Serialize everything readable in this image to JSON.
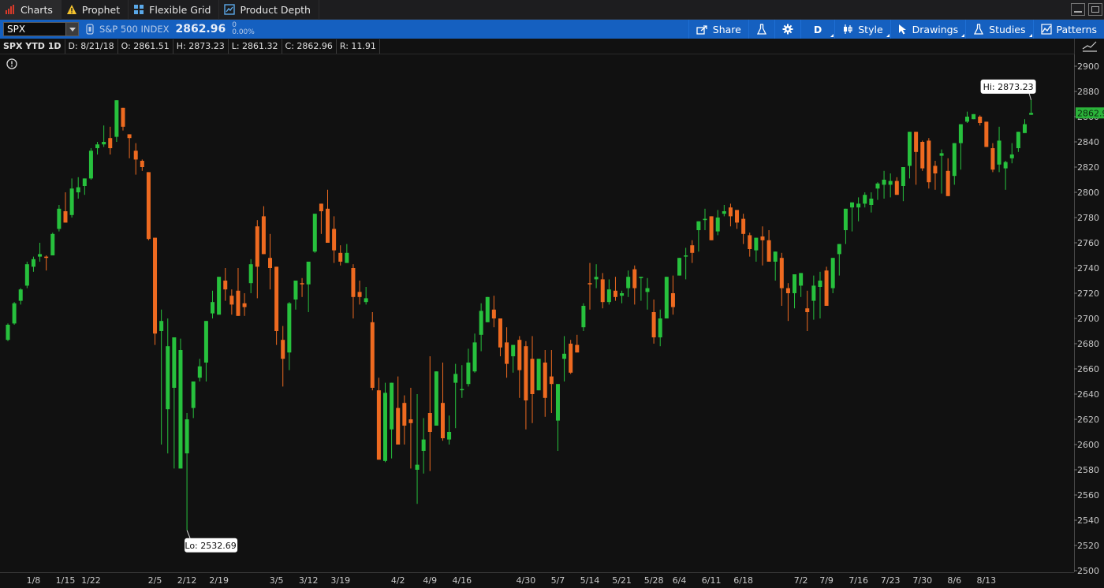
{
  "tabs": [
    {
      "label": "Charts",
      "icon": "bar-chart-icon"
    },
    {
      "label": "Prophet",
      "icon": "warning-triangle-icon"
    },
    {
      "label": "Flexible Grid",
      "icon": "grid-icon"
    },
    {
      "label": "Product Depth",
      "icon": "depth-chart-icon"
    }
  ],
  "toolbar": {
    "symbol": "SPX",
    "description": "S&P 500 INDEX",
    "last_price": "2862.96",
    "change": "0",
    "change_pct": "0.00%",
    "buttons": {
      "share": "Share",
      "aggregation": "D",
      "style": "Style",
      "drawings": "Drawings",
      "studies": "Studies",
      "patterns": "Patterns"
    }
  },
  "infobar": {
    "title": "SPX YTD 1D",
    "date": "D: 8/21/18",
    "open": "O: 2861.51",
    "high": "H: 2873.23",
    "low": "L: 2861.32",
    "close": "C: 2862.96",
    "range": "R: 11.91"
  },
  "colors": {
    "up": "#27c13d",
    "down": "#ee6a20",
    "background": "#111111",
    "toolbar": "#1560c0",
    "last_price_tag": "#2bb33a"
  },
  "chart_data": {
    "type": "candlestick",
    "ylim": [
      2500,
      2910
    ],
    "y_ticks": [
      2500,
      2520,
      2540,
      2560,
      2580,
      2600,
      2620,
      2640,
      2660,
      2680,
      2700,
      2720,
      2740,
      2760,
      2780,
      2800,
      2820,
      2840,
      2860,
      2880,
      2900
    ],
    "x_tick_labels": [
      {
        "label": "1/8",
        "index": 4
      },
      {
        "label": "1/15",
        "index": 9
      },
      {
        "label": "1/22",
        "index": 13
      },
      {
        "label": "2/5",
        "index": 23
      },
      {
        "label": "2/12",
        "index": 28
      },
      {
        "label": "2/19",
        "index": 33
      },
      {
        "label": "3/5",
        "index": 42
      },
      {
        "label": "3/12",
        "index": 47
      },
      {
        "label": "3/19",
        "index": 52
      },
      {
        "label": "4/2",
        "index": 61
      },
      {
        "label": "4/9",
        "index": 66
      },
      {
        "label": "4/16",
        "index": 71
      },
      {
        "label": "4/30",
        "index": 81
      },
      {
        "label": "5/7",
        "index": 86
      },
      {
        "label": "5/14",
        "index": 91
      },
      {
        "label": "5/21",
        "index": 96
      },
      {
        "label": "5/28",
        "index": 101
      },
      {
        "label": "6/4",
        "index": 105
      },
      {
        "label": "6/11",
        "index": 110
      },
      {
        "label": "6/18",
        "index": 115
      },
      {
        "label": "7/2",
        "index": 124
      },
      {
        "label": "7/9",
        "index": 128
      },
      {
        "label": "7/16",
        "index": 133
      },
      {
        "label": "7/23",
        "index": 138
      },
      {
        "label": "7/30",
        "index": 143
      },
      {
        "label": "8/6",
        "index": 148
      },
      {
        "label": "8/13",
        "index": 153
      }
    ],
    "hi_label": "Hi: 2873.23",
    "lo_label": "Lo: 2532.69",
    "last_price_label": "2862.96",
    "candles": [
      [
        2683,
        2696,
        2682,
        2695
      ],
      [
        2696,
        2713,
        2695,
        2712
      ],
      [
        2714,
        2724,
        2711,
        2723
      ],
      [
        2726,
        2745,
        2724,
        2743
      ],
      [
        2741,
        2749,
        2737,
        2747
      ],
      [
        2749,
        2760,
        2745,
        2751
      ],
      [
        2749,
        2750,
        2738,
        2748
      ],
      [
        2750,
        2768,
        2750,
        2767
      ],
      [
        2771,
        2790,
        2769,
        2787
      ],
      [
        2785,
        2800,
        2777,
        2776
      ],
      [
        2782,
        2811,
        2780,
        2803
      ],
      [
        2800,
        2812,
        2795,
        2804
      ],
      [
        2805,
        2810,
        2798,
        2811
      ],
      [
        2811,
        2835,
        2810,
        2833
      ],
      [
        2835,
        2840,
        2830,
        2838
      ],
      [
        2838,
        2853,
        2836,
        2840
      ],
      [
        2843,
        2852,
        2830,
        2835
      ],
      [
        2844,
        2873,
        2840,
        2873
      ],
      [
        2867,
        2866,
        2849,
        2852
      ],
      [
        2846,
        2835,
        2827,
        2843
      ],
      [
        2833,
        2839,
        2814,
        2826
      ],
      [
        2825,
        2826,
        2817,
        2820
      ],
      [
        2816,
        2807,
        2762,
        2763
      ],
      [
        2764,
        2745,
        2679,
        2688
      ],
      [
        2690,
        2707,
        2600,
        2698
      ],
      [
        2628,
        2700,
        2593,
        2678
      ],
      [
        2645,
        2677,
        2581,
        2685
      ],
      [
        2581,
        2684,
        2596,
        2675
      ],
      [
        2593,
        2625,
        2532,
        2620
      ],
      [
        2629,
        2640,
        2621,
        2650
      ],
      [
        2653,
        2668,
        2650,
        2662
      ],
      [
        2665,
        2693,
        2650,
        2698
      ],
      [
        2704,
        2722,
        2700,
        2713
      ],
      [
        2703,
        2733,
        2711,
        2733
      ],
      [
        2730,
        2740,
        2714,
        2723
      ],
      [
        2718,
        2723,
        2703,
        2711
      ],
      [
        2722,
        2740,
        2711,
        2702
      ],
      [
        2712,
        2720,
        2702,
        2709
      ],
      [
        2728,
        2747,
        2720,
        2743
      ],
      [
        2773,
        2778,
        2716,
        2741
      ],
      [
        2781,
        2789,
        2757,
        2751
      ],
      [
        2748,
        2767,
        2723,
        2740
      ],
      [
        2741,
        2730,
        2679,
        2690
      ],
      [
        2683,
        2694,
        2646,
        2668
      ],
      [
        2673,
        2713,
        2659,
        2712
      ],
      [
        2715,
        2730,
        2707,
        2730
      ],
      [
        2728,
        2732,
        2717,
        2727
      ],
      [
        2727,
        2742,
        2705,
        2745
      ],
      [
        2753,
        2783,
        2752,
        2783
      ],
      [
        2791,
        2788,
        2767,
        2785
      ],
      [
        2787,
        2802,
        2777,
        2760
      ],
      [
        2771,
        2781,
        2744,
        2754
      ],
      [
        2752,
        2758,
        2742,
        2745
      ],
      [
        2744,
        2759,
        2747,
        2752
      ],
      [
        2740,
        2743,
        2700,
        2717
      ],
      [
        2721,
        2730,
        2711,
        2717
      ],
      [
        2713,
        2725,
        2711,
        2716
      ],
      [
        2697,
        2705,
        2643,
        2645
      ],
      [
        2643,
        2653,
        2594,
        2588
      ],
      [
        2587,
        2649,
        2586,
        2641
      ],
      [
        2612,
        2649,
        2589,
        2649
      ],
      [
        2629,
        2654,
        2615,
        2600
      ],
      [
        2633,
        2639,
        2600,
        2615
      ],
      [
        2620,
        2645,
        2581,
        2617
      ],
      [
        2580,
        2640,
        2553,
        2584
      ],
      [
        2595,
        2621,
        2577,
        2604
      ],
      [
        2625,
        2670,
        2579,
        2610
      ],
      [
        2615,
        2653,
        2624,
        2658
      ],
      [
        2633,
        2665,
        2603,
        2605
      ],
      [
        2604,
        2623,
        2600,
        2610
      ],
      [
        2649,
        2664,
        2613,
        2656
      ],
      [
        2644,
        2663,
        2637,
        2644
      ],
      [
        2648,
        2676,
        2646,
        2665
      ],
      [
        2658,
        2688,
        2657,
        2681
      ],
      [
        2687,
        2712,
        2674,
        2706
      ],
      [
        2697,
        2712,
        2702,
        2717
      ],
      [
        2707,
        2718,
        2693,
        2700
      ],
      [
        2700,
        2686,
        2670,
        2677
      ],
      [
        2681,
        2693,
        2653,
        2664
      ],
      [
        2670,
        2679,
        2657,
        2679
      ],
      [
        2683,
        2686,
        2637,
        2659
      ],
      [
        2678,
        2682,
        2612,
        2635
      ],
      [
        2668,
        2686,
        2617,
        2640
      ],
      [
        2643,
        2655,
        2653,
        2668
      ],
      [
        2665,
        2675,
        2622,
        2637
      ],
      [
        2654,
        2675,
        2625,
        2648
      ],
      [
        2619,
        2648,
        2595,
        2648
      ],
      [
        2668,
        2686,
        2650,
        2672
      ],
      [
        2680,
        2683,
        2656,
        2657
      ],
      [
        2679,
        2687,
        2673,
        2673
      ],
      [
        2693,
        2712,
        2690,
        2710
      ],
      [
        2728,
        2744,
        2707,
        2727
      ],
      [
        2731,
        2743,
        2724,
        2733
      ],
      [
        2731,
        2736,
        2708,
        2713
      ],
      [
        2713,
        2731,
        2711,
        2723
      ],
      [
        2722,
        2733,
        2714,
        2717
      ],
      [
        2718,
        2722,
        2712,
        2720
      ],
      [
        2724,
        2738,
        2717,
        2733
      ],
      [
        2739,
        2742,
        2711,
        2724
      ],
      [
        2732,
        2730,
        2714,
        2733
      ],
      [
        2721,
        2732,
        2707,
        2724
      ],
      [
        2705,
        2715,
        2680,
        2685
      ],
      [
        2685,
        2707,
        2678,
        2700
      ],
      [
        2700,
        2729,
        2707,
        2733
      ],
      [
        2720,
        2734,
        2703,
        2709
      ],
      [
        2734,
        2736,
        2735,
        2748
      ],
      [
        2749,
        2756,
        2731,
        2750
      ],
      [
        2758,
        2762,
        2744,
        2752
      ],
      [
        2770,
        2771,
        2753,
        2777
      ],
      [
        2778,
        2787,
        2770,
        2779
      ],
      [
        2781,
        2781,
        2762,
        2762
      ],
      [
        2769,
        2786,
        2766,
        2780
      ],
      [
        2783,
        2790,
        2781,
        2785
      ],
      [
        2788,
        2791,
        2773,
        2781
      ],
      [
        2786,
        2783,
        2771,
        2776
      ],
      [
        2779,
        2783,
        2759,
        2767
      ],
      [
        2766,
        2768,
        2749,
        2755
      ],
      [
        2754,
        2763,
        2745,
        2764
      ],
      [
        2765,
        2773,
        2742,
        2762
      ],
      [
        2762,
        2770,
        2750,
        2745
      ],
      [
        2745,
        2752,
        2730,
        2753
      ],
      [
        2748,
        2752,
        2710,
        2724
      ],
      [
        2724,
        2728,
        2698,
        2720
      ],
      [
        2720,
        2729,
        2708,
        2735
      ],
      [
        2726,
        2735,
        2717,
        2736
      ],
      [
        2708,
        2722,
        2690,
        2705
      ],
      [
        2714,
        2734,
        2699,
        2726
      ],
      [
        2725,
        2737,
        2700,
        2730
      ],
      [
        2738,
        2741,
        2712,
        2710
      ],
      [
        2724,
        2740,
        2720,
        2748
      ],
      [
        2751,
        2759,
        2734,
        2759
      ],
      [
        2770,
        2770,
        2759,
        2787
      ],
      [
        2788,
        2789,
        2769,
        2792
      ],
      [
        2788,
        2796,
        2777,
        2791
      ],
      [
        2791,
        2800,
        2788,
        2798
      ],
      [
        2790,
        2800,
        2784,
        2795
      ],
      [
        2803,
        2808,
        2794,
        2807
      ],
      [
        2806,
        2817,
        2795,
        2810
      ],
      [
        2806,
        2815,
        2796,
        2809
      ],
      [
        2809,
        2812,
        2800,
        2798
      ],
      [
        2805,
        2812,
        2793,
        2820
      ],
      [
        2821,
        2830,
        2811,
        2848
      ],
      [
        2848,
        2848,
        2806,
        2832
      ],
      [
        2840,
        2841,
        2817,
        2819
      ],
      [
        2841,
        2843,
        2803,
        2808
      ],
      [
        2821,
        2825,
        2802,
        2815
      ],
      [
        2829,
        2834,
        2799,
        2831
      ],
      [
        2817,
        2827,
        2812,
        2797
      ],
      [
        2813,
        2827,
        2806,
        2839
      ],
      [
        2839,
        2851,
        2818,
        2854
      ],
      [
        2856,
        2864,
        2855,
        2860
      ],
      [
        2858,
        2860,
        2861,
        2862
      ],
      [
        2860,
        2861,
        2853,
        2855
      ],
      [
        2856,
        2844,
        2838,
        2836
      ],
      [
        2835,
        2839,
        2816,
        2818
      ],
      [
        2822,
        2852,
        2816,
        2841
      ],
      [
        2819,
        2825,
        2802,
        2824
      ],
      [
        2827,
        2839,
        2823,
        2830
      ],
      [
        2835,
        2846,
        2832,
        2848
      ],
      [
        2847,
        2858,
        2847,
        2854
      ],
      [
        2861.51,
        2873.23,
        2861.32,
        2862.96
      ]
    ]
  }
}
